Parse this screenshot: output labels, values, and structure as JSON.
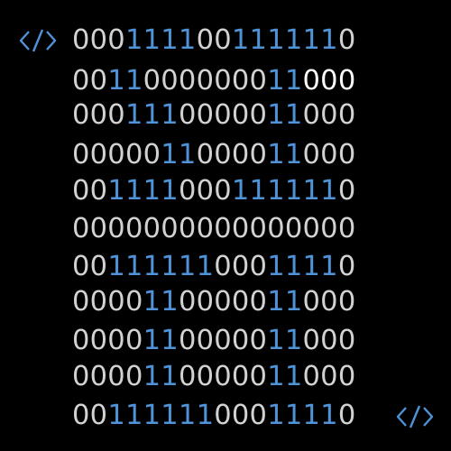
{
  "icons": {
    "top_left": "code-tag-icon",
    "bottom_right": "code-tag-icon"
  },
  "colors": {
    "background": "#000000",
    "zero_digit": "#d2d2d2",
    "one_digit": "#4f93d8",
    "highlight_zero": "#ffffff"
  },
  "rows": [
    {
      "segments": [
        {
          "text": "000",
          "tone": "dim"
        },
        {
          "text": "1111",
          "tone": "blue"
        },
        {
          "text": "00",
          "tone": "dim"
        },
        {
          "text": "111111",
          "tone": "blue"
        },
        {
          "text": "0",
          "tone": "dim"
        }
      ]
    },
    {
      "segments": [
        {
          "text": "00",
          "tone": "dim"
        },
        {
          "text": "11",
          "tone": "blue"
        },
        {
          "text": "0000000",
          "tone": "dim"
        },
        {
          "text": "11",
          "tone": "blue"
        },
        {
          "text": "000",
          "tone": "white"
        }
      ]
    },
    {
      "segments": [
        {
          "text": "000",
          "tone": "dim"
        },
        {
          "text": "111",
          "tone": "blue"
        },
        {
          "text": "00000",
          "tone": "dim"
        },
        {
          "text": "11",
          "tone": "blue"
        },
        {
          "text": "000",
          "tone": "dim"
        }
      ]
    },
    {
      "segments": [
        {
          "text": "00000",
          "tone": "dim"
        },
        {
          "text": "11",
          "tone": "blue"
        },
        {
          "text": "0000",
          "tone": "dim"
        },
        {
          "text": "11",
          "tone": "blue"
        },
        {
          "text": "000",
          "tone": "dim"
        }
      ]
    },
    {
      "segments": [
        {
          "text": "00",
          "tone": "dim"
        },
        {
          "text": "1111",
          "tone": "blue"
        },
        {
          "text": "000",
          "tone": "dim"
        },
        {
          "text": "111111",
          "tone": "blue"
        },
        {
          "text": "0",
          "tone": "dim"
        }
      ]
    },
    {
      "segments": [
        {
          "text": "0000000000000000",
          "tone": "dim"
        }
      ]
    },
    {
      "segments": [
        {
          "text": "00",
          "tone": "dim"
        },
        {
          "text": "111111",
          "tone": "blue"
        },
        {
          "text": "000",
          "tone": "dim"
        },
        {
          "text": "1111",
          "tone": "blue"
        },
        {
          "text": "0",
          "tone": "dim"
        }
      ]
    },
    {
      "segments": [
        {
          "text": "0000",
          "tone": "dim"
        },
        {
          "text": "11",
          "tone": "blue"
        },
        {
          "text": "00000",
          "tone": "dim"
        },
        {
          "text": "11",
          "tone": "blue"
        },
        {
          "text": "000",
          "tone": "dim"
        }
      ]
    },
    {
      "segments": [
        {
          "text": "0000",
          "tone": "dim"
        },
        {
          "text": "11",
          "tone": "blue"
        },
        {
          "text": "00000",
          "tone": "dim"
        },
        {
          "text": "11",
          "tone": "blue"
        },
        {
          "text": "000",
          "tone": "dim"
        }
      ]
    },
    {
      "segments": [
        {
          "text": "0000",
          "tone": "dim"
        },
        {
          "text": "11",
          "tone": "blue"
        },
        {
          "text": "00000",
          "tone": "dim"
        },
        {
          "text": "11",
          "tone": "blue"
        },
        {
          "text": "000",
          "tone": "dim"
        }
      ]
    },
    {
      "segments": [
        {
          "text": "00",
          "tone": "dim"
        },
        {
          "text": "111111",
          "tone": "blue"
        },
        {
          "text": "000",
          "tone": "dim"
        },
        {
          "text": "1111",
          "tone": "blue"
        },
        {
          "text": "0",
          "tone": "dim"
        }
      ]
    }
  ]
}
